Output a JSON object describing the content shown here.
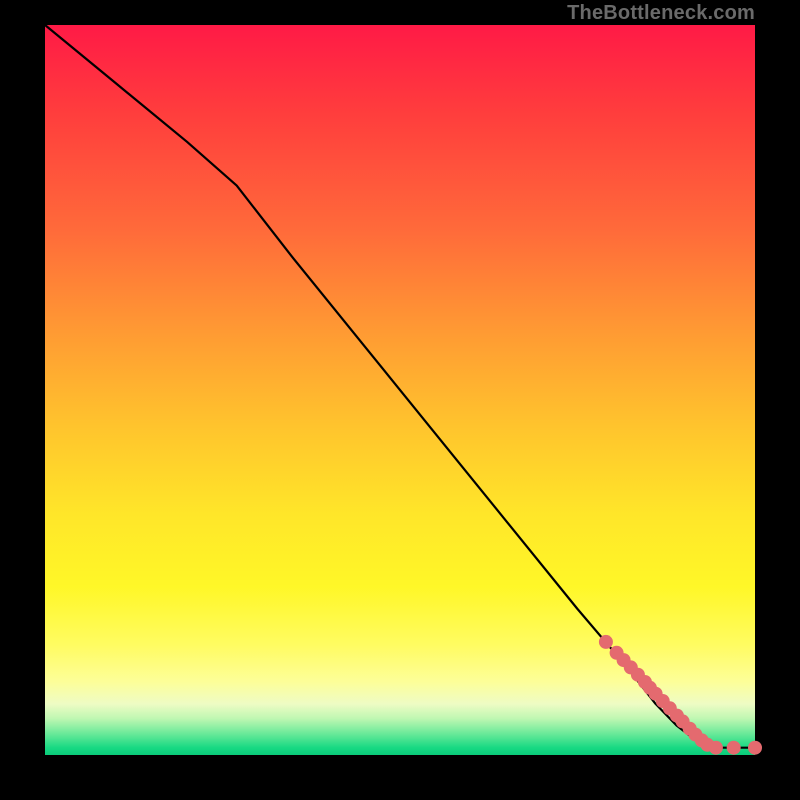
{
  "attribution": "TheBottleneck.com",
  "chart_data": {
    "type": "line",
    "title": "",
    "xlabel": "",
    "ylabel": "",
    "xlim": [
      0,
      100
    ],
    "ylim": [
      0,
      100
    ],
    "grid": false,
    "legend": false,
    "background_gradient": [
      "#ff1a46",
      "#ff9a33",
      "#ffe629",
      "#fdfe99",
      "#0acb7a"
    ],
    "series": [
      {
        "name": "curve",
        "style": "line",
        "x": [
          0,
          10,
          20,
          27,
          35,
          45,
          55,
          65,
          75,
          82,
          86,
          89,
          91,
          93,
          95,
          100
        ],
        "y": [
          100,
          92,
          84,
          78,
          68,
          56,
          44,
          32,
          20,
          12,
          7,
          4,
          2.5,
          1.5,
          1,
          1
        ]
      },
      {
        "name": "points",
        "style": "scatter",
        "x": [
          79,
          80.5,
          81.5,
          82.5,
          83.5,
          84.5,
          85.2,
          86,
          87,
          88,
          89,
          89.8,
          90.8,
          91.6,
          92.5,
          93.3,
          94.5,
          97,
          100
        ],
        "y": [
          15.5,
          14,
          13,
          12,
          11,
          10,
          9.2,
          8.4,
          7.4,
          6.4,
          5.4,
          4.6,
          3.6,
          2.8,
          2,
          1.4,
          1,
          1,
          1
        ]
      }
    ]
  }
}
